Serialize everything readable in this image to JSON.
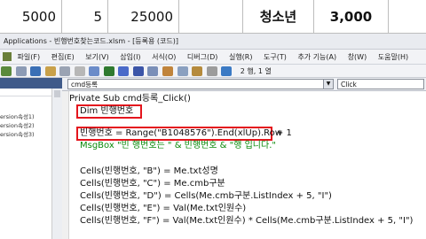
{
  "excel_row": {
    "cells": [
      "5000",
      "5",
      "25000",
      "청소년",
      "3,000"
    ]
  },
  "window_title": "Applications - 빈행번호찾는코드.xlsm - [등록용 (코드)]",
  "menu": [
    "파일(F)",
    "편집(E)",
    "보기(V)",
    "삽입(I)",
    "서식(O)",
    "디버그(D)",
    "실행(R)",
    "도구(T)",
    "추가 기능(A)",
    "창(W)",
    "도움말(H)"
  ],
  "toolbar": {
    "position_label": "2 행, 1 열"
  },
  "project_tree": {
    "items": [
      "ersion속성1)",
      "ersion속성2)",
      "ersion속성3)"
    ]
  },
  "combos": {
    "object": "cmd등록",
    "procedure": "Click"
  },
  "code": {
    "line1": "Private Sub cmd등록_Click()",
    "line2": "Dim 빈행번호",
    "line3": "빈행번호 = Range(\"B1048576\").End(xlUp).Row",
    "line3_suffix": "+ 1",
    "line4": "MsgBox \"빈 행번호는 \" & 빈행번호 & \"행 입니다.\"",
    "line5": "Cells(빈행번호, \"B\") = Me.txt성명",
    "line6": "Cells(빈행번호, \"C\") = Me.cmb구분",
    "line7": "Cells(빈행번호, \"D\") = Cells(Me.cmb구분.ListIndex + 5, \"I\")",
    "line8": "Cells(빈행번호, \"E\") = Val(Me.txt인원수)",
    "line9": "Cells(빈행번호, \"F\") = Val(Me.txt인원수) * Cells(Me.cmb구분.ListIndex + 5, \"I\")"
  },
  "colors": {
    "highlight_box": "#e4151d",
    "comment_green": "#0a8a0a",
    "panel_header": "#3f5a8a"
  }
}
